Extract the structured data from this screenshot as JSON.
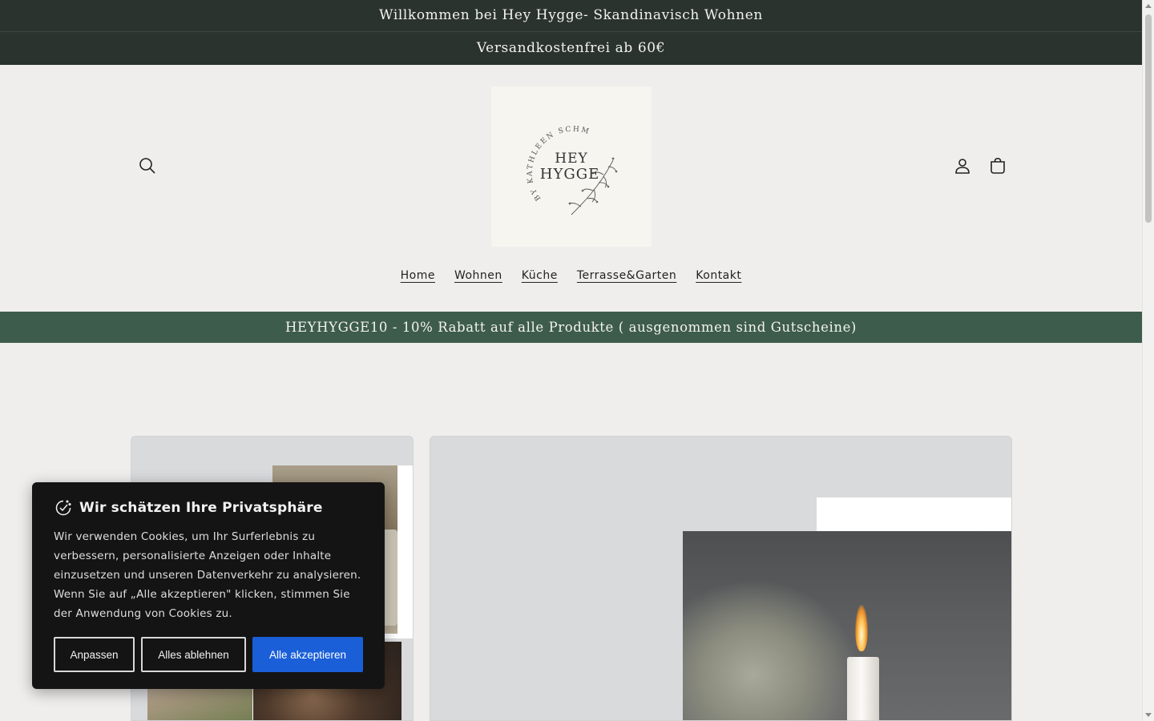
{
  "announcements": {
    "welcome": "Willkommen bei Hey Hygge- Skandinavisch Wohnen",
    "shipping": "Versandkostenfrei ab 60€"
  },
  "header": {
    "logo_arc_text": "BY KATHLEEN SCHMIDT",
    "logo_line1": "HEY",
    "logo_line2": "HYGGE",
    "icons": [
      "search-icon",
      "account-icon",
      "cart-icon"
    ]
  },
  "nav": {
    "items": [
      "Home",
      "Wohnen",
      "Küche",
      "Terrasse&Garten",
      "Kontakt"
    ]
  },
  "promo": {
    "text": "HEYHYGGE10 - 10% Rabatt auf alle Produkte ( ausgenommen sind Gutscheine)"
  },
  "cookie_banner": {
    "title": "Wir schätzen Ihre Privatsphäre",
    "body": "Wir verwenden Cookies, um Ihr Surferlebnis zu verbessern, personalisierte Anzeigen oder Inhalte einzusetzen und unseren Datenverkehr zu analysieren. Wenn Sie auf „Alle akzeptieren\" klicken, stimmen Sie der Anwendung von Cookies zu.",
    "customize_label": "Anpassen",
    "reject_label": "Alles ablehnen",
    "accept_label": "Alle akzeptieren",
    "accept_color": "#1a5fd8"
  },
  "colors": {
    "announcement_bg": "#2b332f",
    "promo_bg": "#3e5c4c",
    "page_bg": "#efeeec"
  }
}
